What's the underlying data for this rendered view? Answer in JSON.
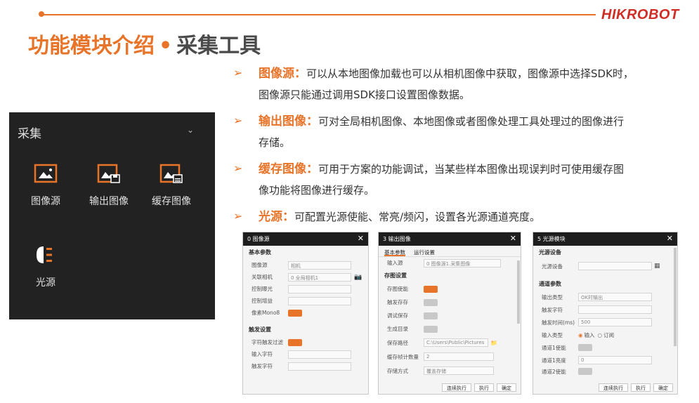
{
  "brand": "HIKROBOT",
  "title": {
    "main": "功能模块介绍",
    "sep": "•",
    "sub": "采集工具"
  },
  "bullets": [
    {
      "name": "图像源：",
      "line1": "可以从本地图像加载也可以从相机图像中获取，图像源中选择SDK时，",
      "line2": "图像源只能通过调用SDK接口设置图像数据。"
    },
    {
      "name": "输出图像：",
      "line1": "可对全局相机图像、本地图像或者图像处理工具处理过的图像进行",
      "line2": "存储。"
    },
    {
      "name": "缓存图像：",
      "line1": "可用于方案的功能调试，当某些样本图像出现误判时可使用缓存图",
      "line2": "像功能将图像进行缓存。"
    },
    {
      "name": "光源：",
      "line1": "可配置光源使能、常亮/频闪，设置各光源通道亮度。",
      "line2": ""
    }
  ],
  "panel": {
    "title": "采集",
    "tools": [
      {
        "label": "图像源",
        "icon": "image-source-icon"
      },
      {
        "label": "输出图像",
        "icon": "output-image-icon"
      },
      {
        "label": "缓存图像",
        "icon": "cache-image-icon"
      },
      {
        "label": "光源",
        "icon": "light-source-icon"
      }
    ]
  },
  "dlg1": {
    "title": "0 图像源",
    "sec1": "基本参数",
    "r1": "图像源",
    "v1": "相机",
    "r2": "关联相机",
    "v2": "0 全局相机1",
    "r3": "控制曝光",
    "r4": "控制增益",
    "r5": "像素Mono8",
    "sec2": "触发设置",
    "r6": "字符触发过滤",
    "r7": "输入字符",
    "r8": "触发字符"
  },
  "dlg2": {
    "title": "3 输出图像",
    "tab1": "基本参数",
    "tab2": "运行设置",
    "r0": "输入源",
    "v0": "0 图像源1.采集图像",
    "sec": "存图设置",
    "r1": "存图使能",
    "r2": "触发存存",
    "r3": "调试保存",
    "r4": "生成目录",
    "r5": "保存路径",
    "v5": "C:\\Users\\Public\\Pictures",
    "r6": "缓存帧计数量",
    "v6": "2",
    "r7": "存储方式",
    "v7": "覆盖存储",
    "b1": "连续执行",
    "b2": "执行",
    "b3": "确定"
  },
  "dlg3": {
    "title": "5 光源模块",
    "sec1": "光源设备",
    "r1": "光源设备",
    "sec2": "通道参数",
    "r2": "输出类型",
    "v2": "OK时输出",
    "r3": "触发字符",
    "r4": "触发时间(ms)",
    "v4": "500",
    "r5": "输入类型",
    "v5a": "输入",
    "v5b": "订阅",
    "r6": "通道1使能",
    "r7": "通道1亮度",
    "v7": "0",
    "r8": "通道2使能",
    "b1": "连续执行",
    "b2": "执行",
    "b3": "确定"
  },
  "colors": {
    "accent": "#e8742a",
    "brand": "#d02d25",
    "panel": "#222222"
  }
}
